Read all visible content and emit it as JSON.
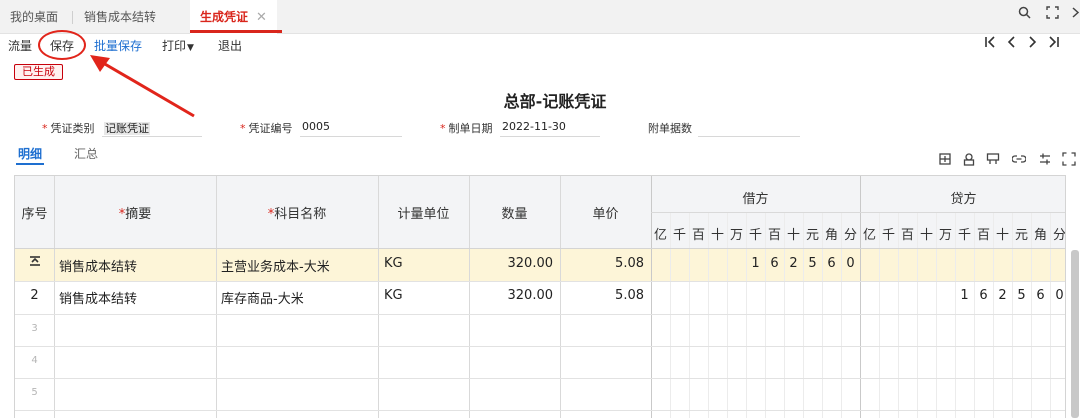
{
  "tabs": [
    {
      "label": "我的桌面"
    },
    {
      "label": "销售成本结转"
    },
    {
      "label": "生成凭证",
      "active": true
    }
  ],
  "tab_close_glyph": "✕",
  "window_icons": [
    "search-icon",
    "restore-icon",
    "close-icon"
  ],
  "toolbar": {
    "flow_label": "流量",
    "save_label": "保存",
    "batch_save_label": "批量保存",
    "print_label": "打印",
    "exit_label": "退出",
    "nav": [
      "|<",
      "<",
      ">",
      ">|"
    ]
  },
  "status_badge": "已生成",
  "voucher": {
    "title": "总部-记账凭证",
    "type_label": "凭证类别",
    "type_value": "记账凭证",
    "number_label": "凭证编号",
    "number_value": "0005",
    "date_label": "制单日期",
    "date_value": "2022-11-30",
    "attach_label": "附单据数",
    "attach_value": ""
  },
  "subtabs": [
    {
      "label": "明细",
      "active": true
    },
    {
      "label": "汇总"
    }
  ],
  "toolbar_icons": [
    "insert-row-icon",
    "copy-icon",
    "template-icon",
    "link-icon",
    "adjust-icon",
    "fullscreen-icon"
  ],
  "grid": {
    "headers": {
      "seq": "序号",
      "summary": "摘要",
      "account": "科目名称",
      "unit": "计量单位",
      "qty": "数量",
      "price": "单价",
      "debit": "借方",
      "credit": "贷方"
    },
    "digit_headers": [
      "亿",
      "千",
      "百",
      "十",
      "万",
      "千",
      "百",
      "十",
      "元",
      "角",
      "分"
    ],
    "rows": [
      {
        "seq": "",
        "summary": "销售成本结转",
        "account": "主营业务成本-大米",
        "unit": "KG",
        "qty": "320.00",
        "price": "5.08",
        "debit_digits": [
          "",
          "",
          "",
          "",
          "",
          "1",
          "6",
          "2",
          "5",
          "6",
          "0"
        ],
        "credit_digits": [
          "",
          "",
          "",
          "",
          "",
          "",
          "",
          "",
          "",
          "",
          ""
        ]
      },
      {
        "seq": "2",
        "summary": "销售成本结转",
        "account": "库存商品-大米",
        "unit": "KG",
        "qty": "320.00",
        "price": "5.08",
        "debit_digits": [
          "",
          "",
          "",
          "",
          "",
          "",
          "",
          "",
          "",
          "",
          ""
        ],
        "credit_digits": [
          "",
          "",
          "",
          "",
          "",
          "1",
          "6",
          "2",
          "5",
          "6",
          "0"
        ]
      },
      {
        "seq": "3"
      },
      {
        "seq": "4"
      },
      {
        "seq": "5"
      }
    ]
  },
  "colors": {
    "accent": "#d9261c",
    "link": "#1e6fd0",
    "selected_row": "#fdf5d8"
  }
}
